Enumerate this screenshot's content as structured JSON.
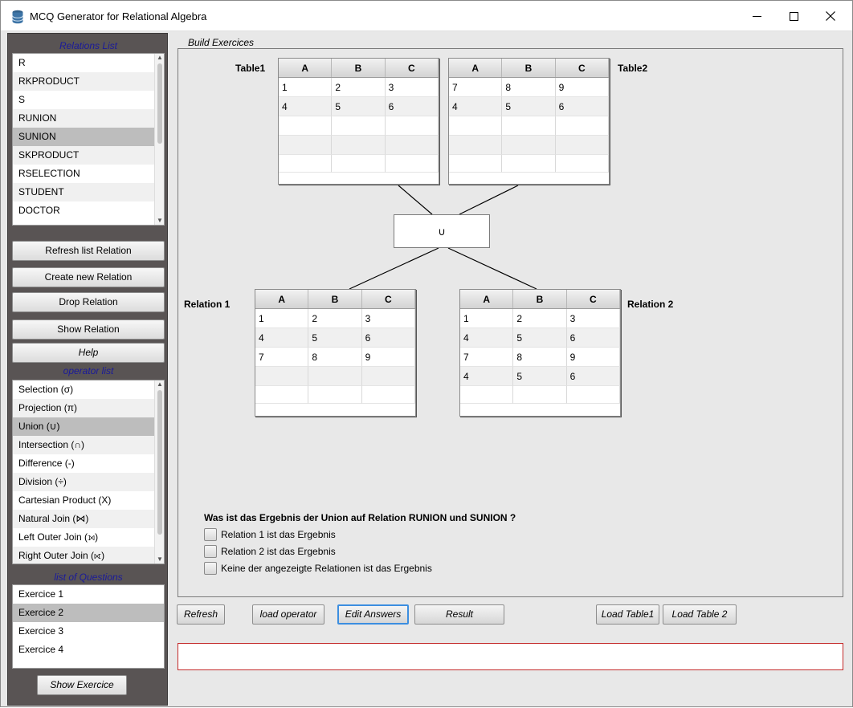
{
  "window": {
    "title": "MCQ Generator for Relational Algebra",
    "minimize": "—",
    "maximize": "☐",
    "close": "✕"
  },
  "sidebar": {
    "relations_label": "Relations List",
    "relations": [
      "R",
      "RKPRODUCT",
      "S",
      "RUNION",
      "SUNION",
      "SKPRODUCT",
      "RSELECTION",
      "STUDENT",
      "DOCTOR"
    ],
    "buttons": {
      "refresh": "Refresh list Relation",
      "create": "Create new Relation",
      "drop": "Drop Relation",
      "show": "Show Relation",
      "help": "Help"
    },
    "operator_label": "operator list",
    "operators": [
      "Selection (σ)",
      "Projection (π)",
      "Union (∪)",
      "Intersection (∩)",
      "Difference (-)",
      "Division (÷)",
      "Cartesian Product (X)",
      "Natural Join (⋈)",
      "Left Outer Join (⟕)",
      "Right Outer Join (⟖)"
    ],
    "questions_label": "list of Questions",
    "questions": [
      "Exercice 1",
      "Exercice 2",
      "Exercice 3",
      "Exercice 4"
    ],
    "show_exercise": "Show Exercice"
  },
  "main": {
    "build_label": "Build Exercices",
    "table1": {
      "label": "Table1",
      "columns": [
        "A",
        "B",
        "C"
      ],
      "rows": [
        [
          "1",
          "2",
          "3"
        ],
        [
          "4",
          "5",
          "6"
        ],
        [
          "",
          "",
          ""
        ],
        [
          "",
          "",
          ""
        ],
        [
          "",
          "",
          ""
        ]
      ]
    },
    "table2": {
      "label": "Table2",
      "columns": [
        "A",
        "B",
        "C"
      ],
      "rows": [
        [
          "7",
          "8",
          "9"
        ],
        [
          "4",
          "5",
          "6"
        ],
        [
          "",
          "",
          ""
        ],
        [
          "",
          "",
          ""
        ],
        [
          "",
          "",
          ""
        ]
      ]
    },
    "operator_symbol": "∪",
    "relation1": {
      "label": "Relation 1",
      "columns": [
        "A",
        "B",
        "C"
      ],
      "rows": [
        [
          "1",
          "2",
          "3"
        ],
        [
          "4",
          "5",
          "6"
        ],
        [
          "7",
          "8",
          "9"
        ],
        [
          "",
          "",
          ""
        ],
        [
          "",
          "",
          ""
        ]
      ]
    },
    "relation2": {
      "label": "Relation 2",
      "columns": [
        "A",
        "B",
        "C"
      ],
      "rows": [
        [
          "1",
          "2",
          "3"
        ],
        [
          "4",
          "5",
          "6"
        ],
        [
          "7",
          "8",
          "9"
        ],
        [
          "4",
          "5",
          "6"
        ],
        [
          "",
          "",
          ""
        ]
      ]
    },
    "question": "Was ist das Ergebnis der Union auf Relation RUNION und SUNION  ?",
    "options": [
      "Relation 1 ist das Ergebnis",
      "Relation 2 ist das Ergebnis",
      "Keine der angezeigte Relationen ist das Ergebnis"
    ]
  },
  "toolbar": {
    "refresh": "Refresh",
    "load_operator": "load operator",
    "edit_answers": "Edit Answers",
    "result": "Result",
    "load_table1": "Load Table1",
    "load_table2": "Load Table 2"
  },
  "message": ""
}
